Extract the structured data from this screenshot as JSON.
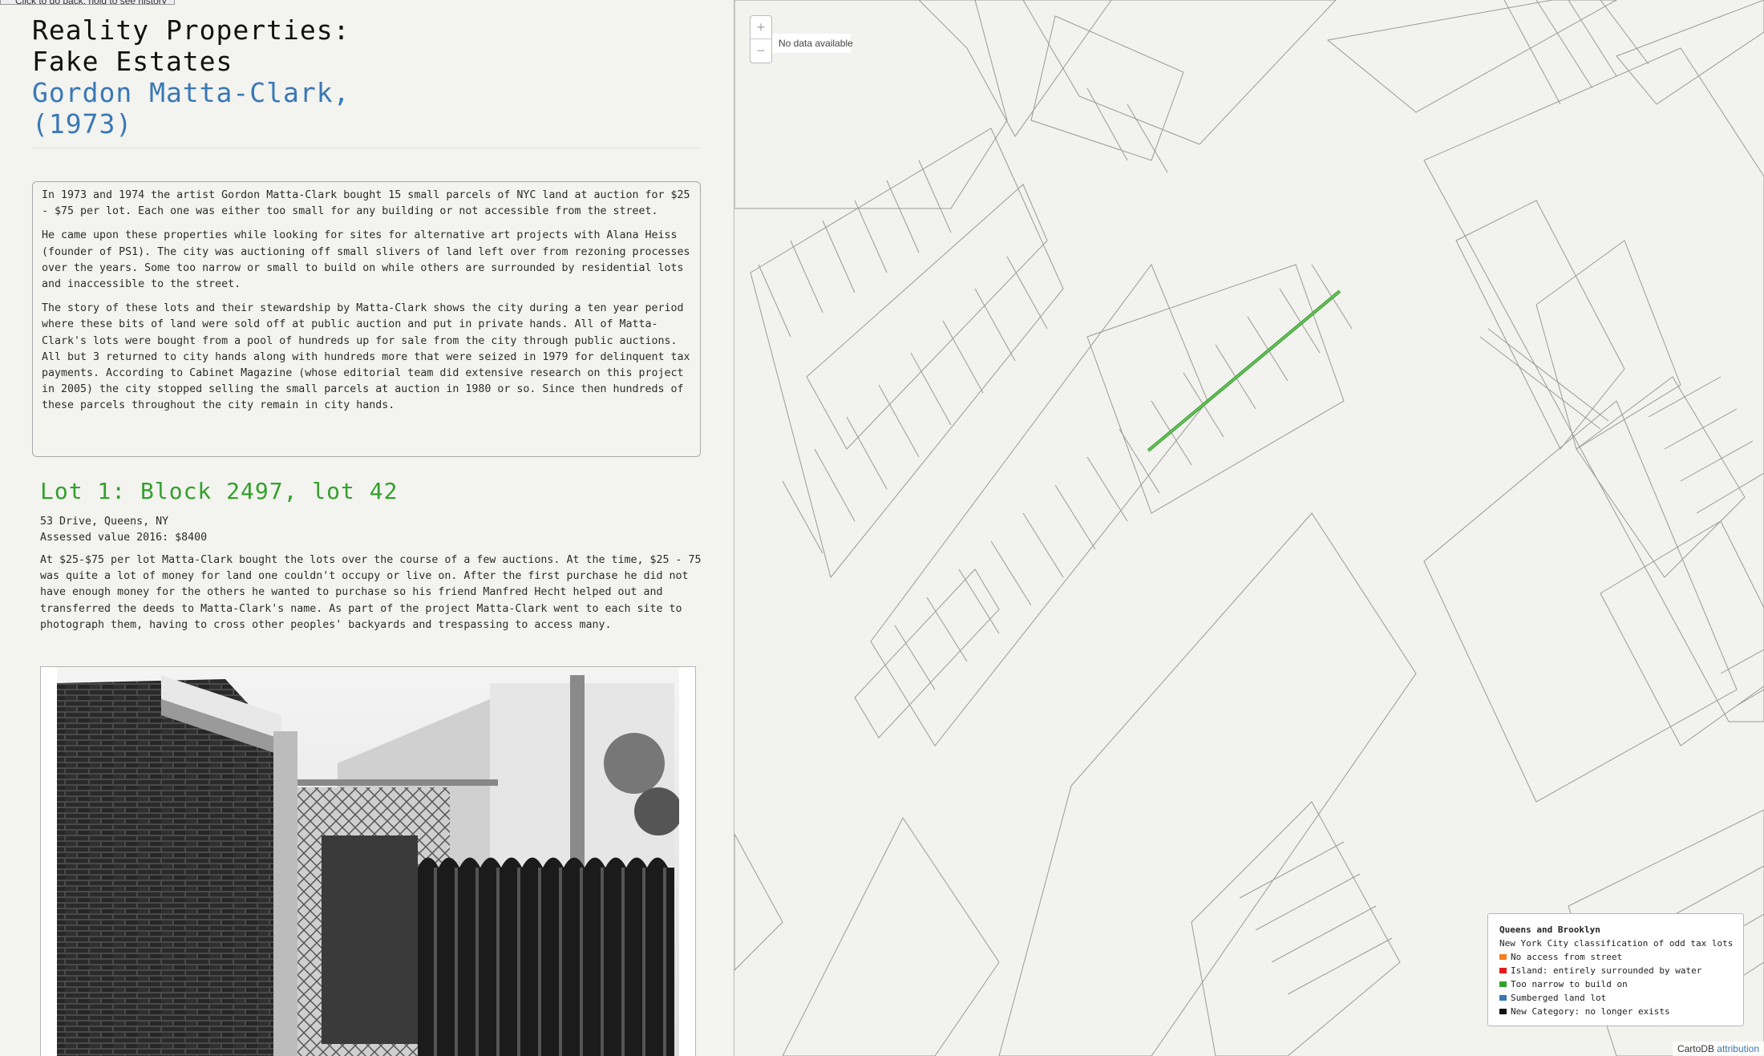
{
  "tooltip": "Click to go back, hold to see history",
  "sidebar": {
    "title_lines": [
      "Reality Properties:",
      "Fake Estates"
    ],
    "subtitle_lines": [
      "Gordon Matta-Clark,",
      "(1973)"
    ],
    "intro": [
      "In 1973 and 1974 the artist Gordon Matta-Clark bought 15 small parcels of NYC land at auction for $25 - $75 per lot. Each one was either too small for any building or not accessible from the street.",
      "He came upon these properties while looking for sites for alternative art projects with Alana Heiss (founder of PS1). The city was auctioning off small slivers of land left over from rezoning processes over the years. Some too narrow or small to build on while others are surrounded by residential lots and inaccessible to the street.",
      "The story of these lots and their stewardship by Matta-Clark shows the city during a ten year period where these bits of land were sold off at public auction and put in private hands. All of Matta-Clark's lots were bought from a pool of hundreds up for sale from the city through public auctions. All but 3 returned to city hands along with hundreds more that were seized in 1979 for delinquent tax payments. According to Cabinet Magazine (whose editorial team did extensive research on this project in 2005) the city stopped selling the small parcels at auction in 1980 or so. Since then hundreds of these parcels throughout the city remain in city hands."
    ],
    "lot": {
      "title": "Lot 1: Block 2497, lot 42",
      "address": "53 Drive, Queens, NY",
      "value": "Assessed value 2016: $8400",
      "body": "At $25-$75 per lot Matta-Clark bought the lots over the course of a few auctions. At the time, $25 - 75 was quite a lot of money for land one couldn't occupy or live on. After the first purchase he did not have enough money for the others he wanted to purchase so his friend Manfred Hecht helped out and transferred the deeds to Matta-Clark's name. As part of the project Matta-Clark went to each site to photograph them, having to cross other peoples' backyards and trespassing to access many."
    }
  },
  "map": {
    "zoom_in": "+",
    "zoom_out": "−",
    "no_data": "No data available",
    "legend": {
      "title": "Queens and Brooklyn",
      "subtitle": "New York City classification of odd tax lots",
      "items": [
        {
          "label": "No access from street",
          "color": "#f57c1f"
        },
        {
          "label": "Island: entirely surrounded by water",
          "color": "#e31a1c"
        },
        {
          "label": "Too narrow to build on",
          "color": "#33a02c"
        },
        {
          "label": "Sumberged land lot",
          "color": "#3a78b5"
        },
        {
          "label": "New Category: no longer exists",
          "color": "#111111"
        }
      ]
    },
    "attribution": {
      "provider": "CartoDB",
      "link": "attribution"
    }
  }
}
